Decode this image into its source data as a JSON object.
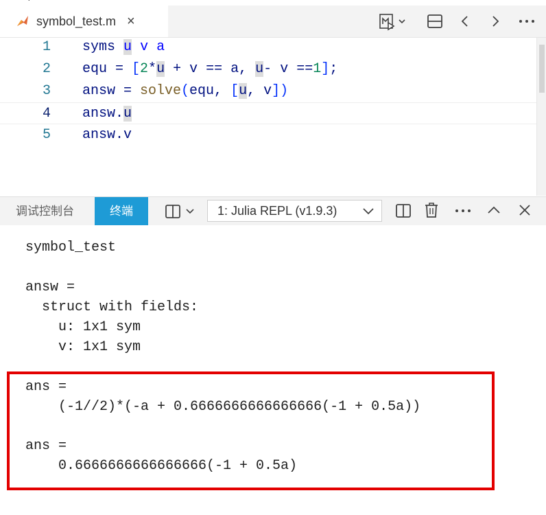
{
  "editor": {
    "tab": {
      "filename": "symbol_test.m",
      "close_glyph": "×"
    },
    "lines": [
      {
        "num": "1"
      },
      {
        "num": "2"
      },
      {
        "num": "3"
      },
      {
        "num": "4"
      },
      {
        "num": "5"
      }
    ],
    "code": {
      "l1": {
        "kw": "syms",
        "a": "u",
        "b": "v",
        "c": "a"
      },
      "l2": {
        "lhs": "equ = ",
        "o1": "[",
        "n2": "2",
        "t1": "*",
        "u1": "u",
        "t2": " + ",
        "v1": "v",
        "t3": " == ",
        "a1": "a",
        "t4": ", ",
        "u2": "u",
        "t5": "- ",
        "v2": "v",
        "t6": " ==",
        "n1": "1",
        "o2": "]",
        "semi": ";"
      },
      "l3": {
        "lhs": "answ = ",
        "fn": "solve",
        "p1": "(",
        "t1": "equ, ",
        "o1": "[",
        "u": "u",
        "t2": ", ",
        "v": "v",
        "o2": "]",
        "p2": ")"
      },
      "l4": {
        "pre": "answ.",
        "u": "u"
      },
      "l5": {
        "pre": "answ.",
        "v": "v"
      }
    }
  },
  "panel": {
    "debug_tab": "调试控制台",
    "terminal_tab": "终端",
    "repl_select": "1: Julia REPL (v1.9.3)"
  },
  "terminal": {
    "lines": [
      "symbol_test",
      "answ =",
      "  struct with fields:",
      "    u: 1x1 sym",
      "    v: 1x1 sym",
      "ans =",
      "    (-1//2)*(-a + 0.6666666666666666(-1 + 0.5a))",
      "ans =",
      "    0.6666666666666666(-1 + 0.5a)"
    ]
  },
  "icons": {
    "tab_file": "matlab-file-icon",
    "tab_close": "close-icon",
    "run": "run-preview-icon",
    "split_editor": "split-editor-icon",
    "nav_back": "chevron-left-icon",
    "nav_forward": "chevron-right-icon",
    "more": "more-actions-icon",
    "layout": "layout-icon",
    "split_terminal": "split-terminal-icon",
    "kill_terminal": "trash-icon",
    "maximize": "chevron-up-icon",
    "close_panel": "close-icon"
  },
  "colors": {
    "terminal_tab_bg": "#1e9bd6",
    "highlight_box": "#e30000",
    "line_numbers": "#237893"
  }
}
